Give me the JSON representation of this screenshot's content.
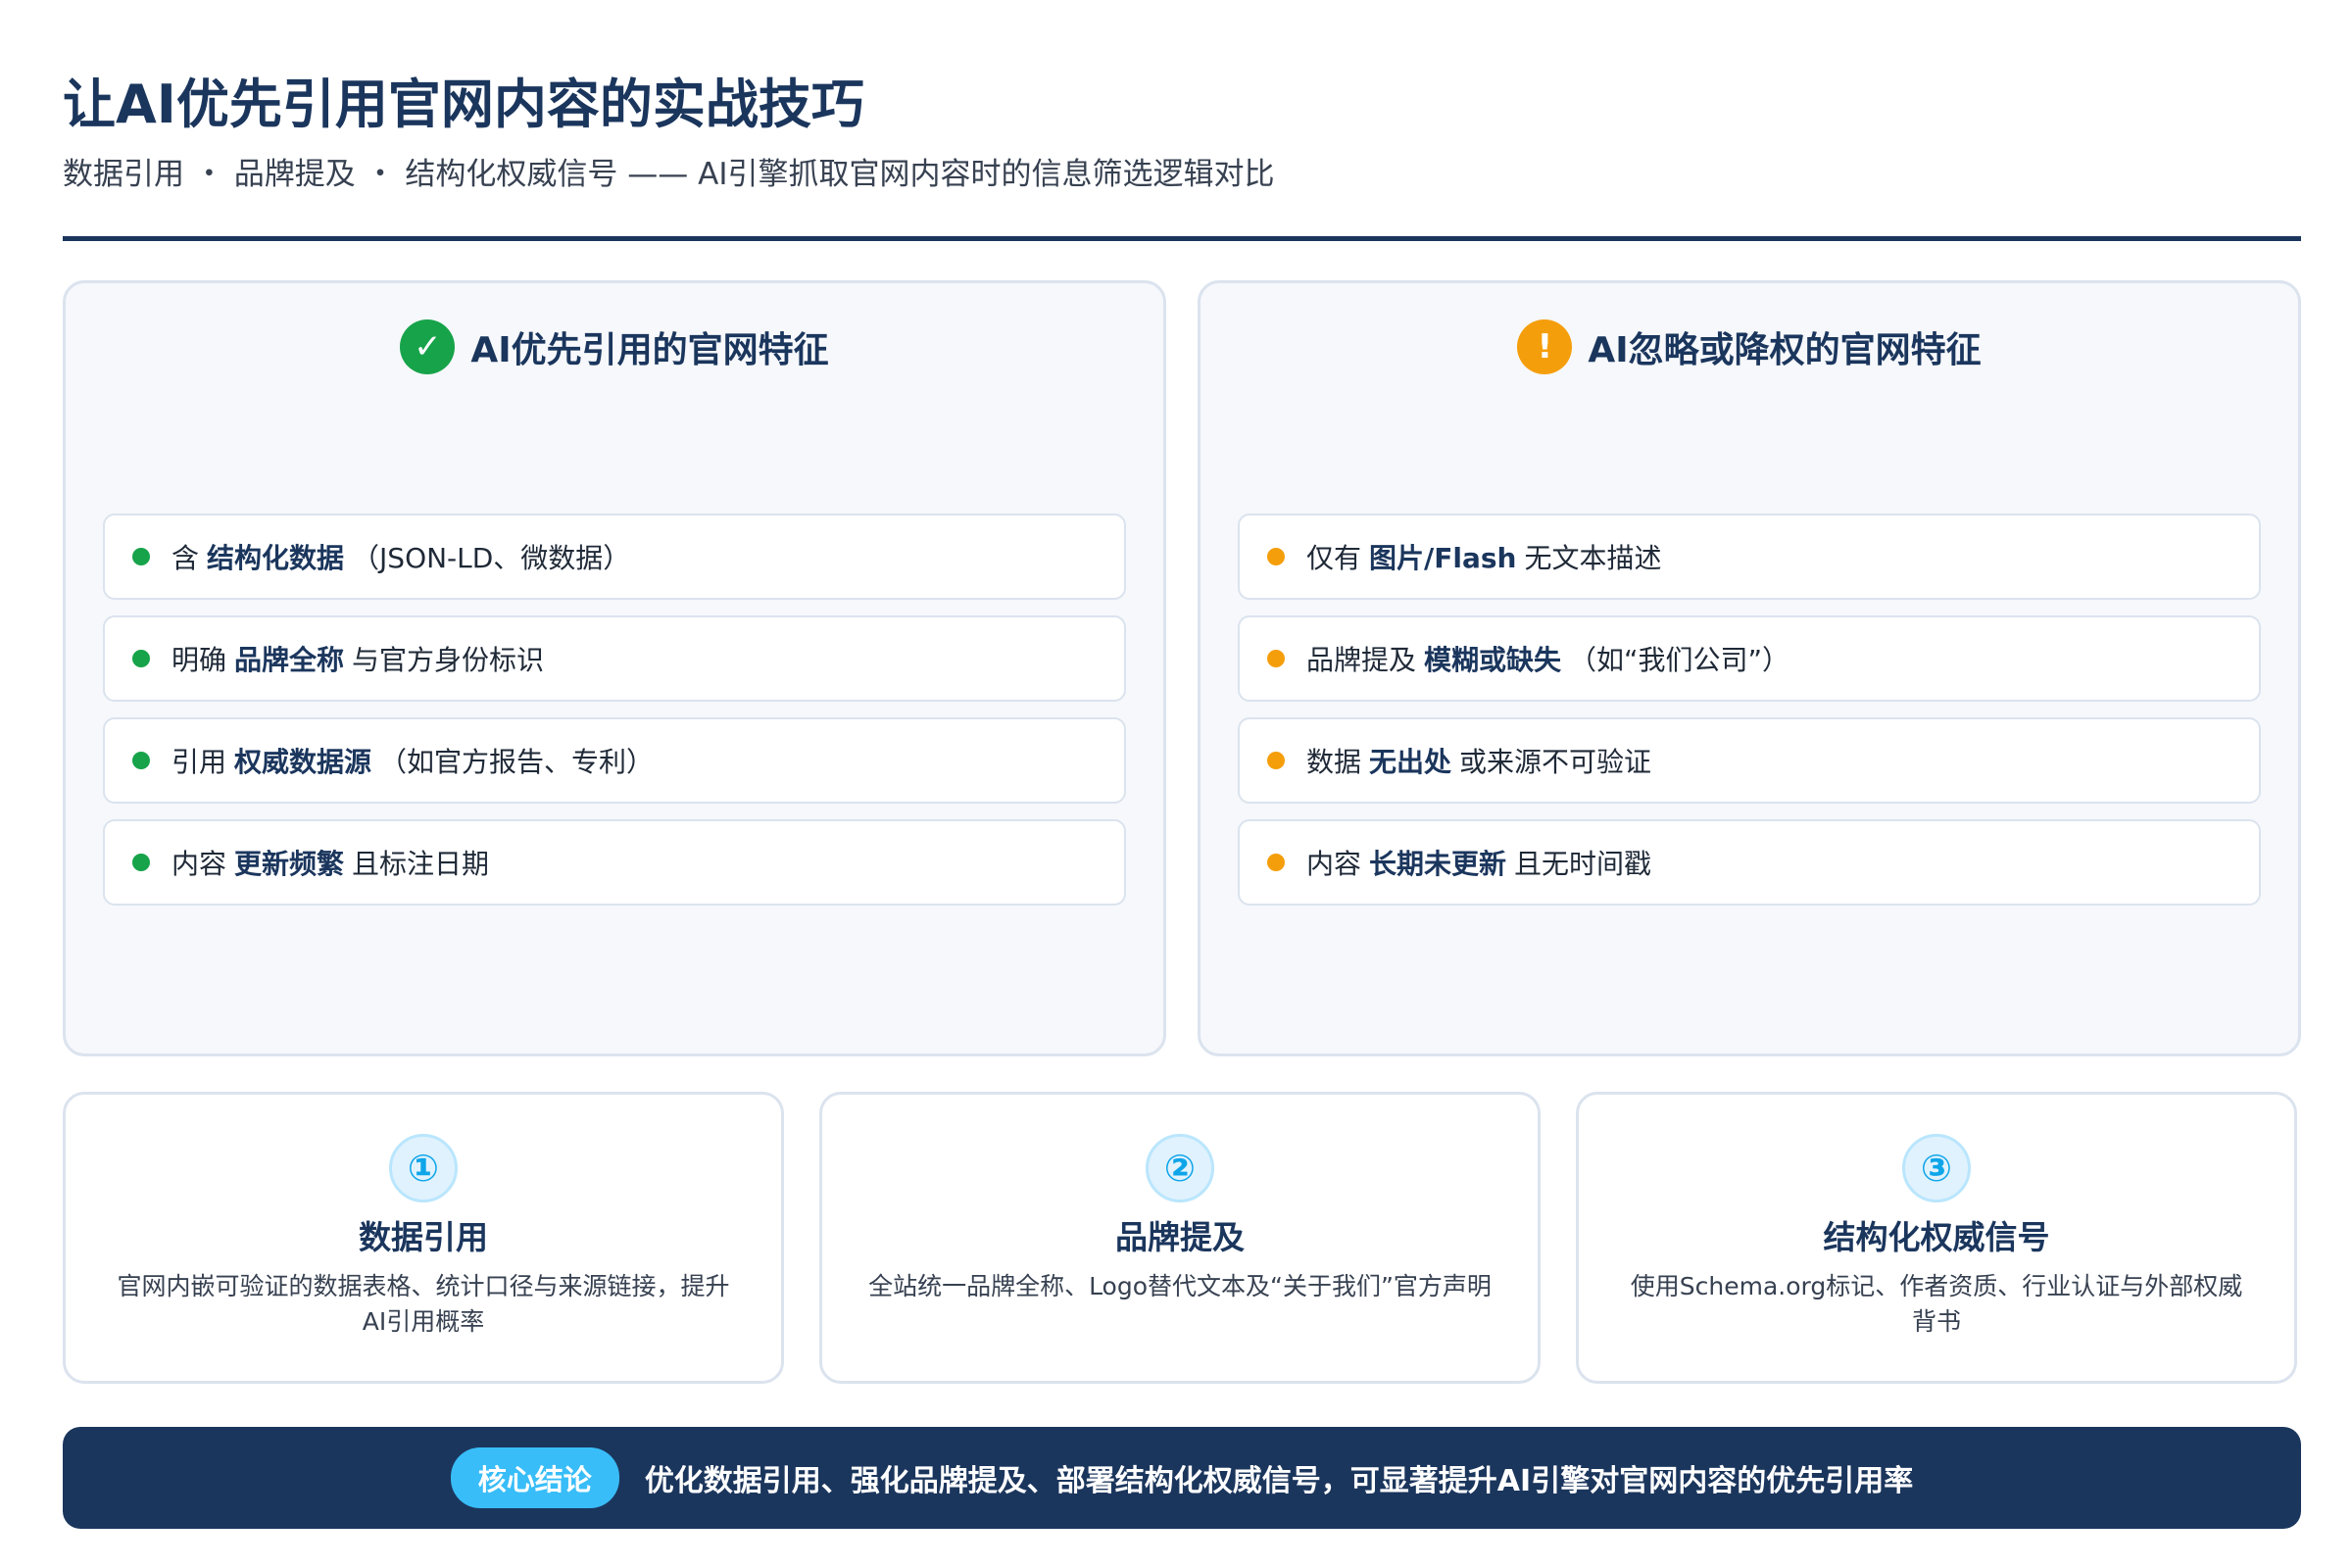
{
  "header": {
    "title": "让AI优先引用官网内容的实战技巧",
    "subtitle": "数据引用 ・ 品牌提及 ・ 结构化权威信号 —— AI引擎抓取官网内容时的信息筛选逻辑对比"
  },
  "left_panel": {
    "icon": "check-icon",
    "icon_glyph": "✓",
    "title": "AI优先引用的官网特征",
    "items": [
      {
        "pre": "含",
        "bold": "结构化数据",
        "post": "（JSON-LD、微数据）"
      },
      {
        "pre": "明确",
        "bold": "品牌全称",
        "post": "与官方身份标识"
      },
      {
        "pre": "引用",
        "bold": "权威数据源",
        "post": "（如官方报告、专利）"
      },
      {
        "pre": "内容",
        "bold": "更新频繁",
        "post": "且标注日期"
      }
    ]
  },
  "right_panel": {
    "icon": "warning-icon",
    "icon_glyph": "!",
    "title": "AI忽略或降权的官网特征",
    "items": [
      {
        "pre": "仅有",
        "bold": "图片/Flash",
        "post": "无文本描述"
      },
      {
        "pre": "品牌提及",
        "bold": "模糊或缺失",
        "post": "（如“我们公司”）"
      },
      {
        "pre": "数据",
        "bold": "无出处",
        "post": "或来源不可验证"
      },
      {
        "pre": "内容",
        "bold": "长期未更新",
        "post": "且无时间戳"
      }
    ]
  },
  "tips": [
    {
      "num": "①",
      "title": "数据引用",
      "desc": "官网内嵌可验证的数据表格、统计口径与来源链接，提升AI引用概率"
    },
    {
      "num": "②",
      "title": "品牌提及",
      "desc": "全站统一品牌全称、Logo替代文本及“关于我们”官方声明"
    },
    {
      "num": "③",
      "title": "结构化权威信号",
      "desc": "使用Schema.org标记、作者资质、行业认证与外部权威背书"
    }
  ],
  "conclusion": {
    "badge": "核心结论",
    "text": "优化数据引用、强化品牌提及、部署结构化权威信号，可显著提升AI引擎对官网内容的优先引用率"
  },
  "colors": {
    "navy": "#1b365d",
    "good": "#16a34a",
    "warn": "#f59e0b",
    "accent": "#38bdf8"
  }
}
